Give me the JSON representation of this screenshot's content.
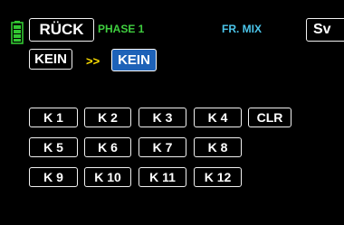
{
  "header": {
    "battery_icon": "battery-icon",
    "back_label": "RÜCK",
    "phase_label": "PHASE 1",
    "title": "FR. MIX",
    "sv_label": "Sv"
  },
  "mix": {
    "source_label": "KEIN",
    "arrow": ">>",
    "destination_label": "KEIN"
  },
  "channels": {
    "k1": "K 1",
    "k2": "K 2",
    "k3": "K 3",
    "k4": "K 4",
    "clear": "CLR",
    "k5": "K 5",
    "k6": "K 6",
    "k7": "K 7",
    "k8": "K 8",
    "k9": "K 9",
    "k10": "K 10",
    "k11": "K 11",
    "k12": "K 12"
  },
  "colors": {
    "background": "#000000",
    "phase_green": "#3fce3f",
    "title_cyan": "#4bc5ea",
    "arrow_yellow": "#ffe000",
    "selected_blue": "#1e62b8",
    "battery_green": "#32c832"
  }
}
